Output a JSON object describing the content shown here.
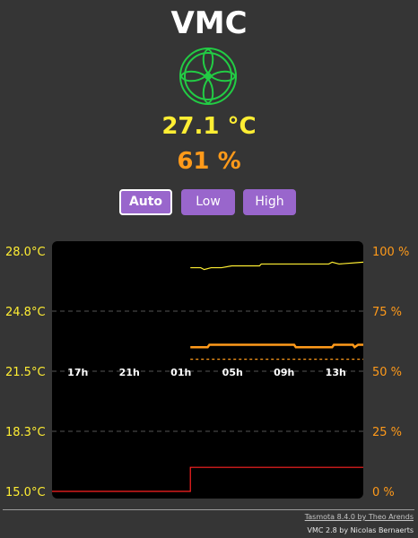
{
  "header": {
    "title": "VMC"
  },
  "readings": {
    "temperature": "27.1 °C",
    "humidity": "61 %"
  },
  "modes": {
    "auto_label": "Auto",
    "low_label": "Low",
    "high_label": "High",
    "selected": "Auto"
  },
  "colors": {
    "background": "#353535",
    "fan_green": "#22cc44",
    "temperature": "#ffee33",
    "humidity": "#ff9a1a",
    "button": "#9966cc",
    "fan_state": "#ff2222"
  },
  "chart_data": {
    "type": "line",
    "x": [
      "17h",
      "21h",
      "01h",
      "05h",
      "09h",
      "13h"
    ],
    "y_left": {
      "ticks": [
        "28.0°C",
        "24.8°C",
        "21.5°C",
        "18.3°C",
        "15.0°C"
      ],
      "range": [
        15.0,
        28.0
      ]
    },
    "y_right": {
      "ticks": [
        "100 %",
        "75 %",
        "50 %",
        "25 %",
        "0 %"
      ],
      "range": [
        0,
        100
      ]
    },
    "grid": true,
    "series": [
      {
        "axis": "left",
        "color": "#ffee33",
        "points": [
          [
            4.0,
            27.1
          ],
          [
            4.3,
            27.1
          ],
          [
            4.4,
            27.0
          ],
          [
            4.6,
            27.1
          ],
          [
            4.9,
            27.1
          ],
          [
            5.2,
            27.2
          ],
          [
            6.0,
            27.2
          ],
          [
            6.05,
            27.3
          ],
          [
            7.0,
            27.3
          ],
          [
            8.0,
            27.3
          ],
          [
            8.1,
            27.4
          ],
          [
            8.3,
            27.3
          ],
          [
            9.0,
            27.4
          ]
        ]
      },
      {
        "axis": "right",
        "color": "#ff9a1a",
        "points": [
          [
            4.0,
            60
          ],
          [
            4.5,
            60
          ],
          [
            4.55,
            61
          ],
          [
            7.0,
            61
          ],
          [
            7.05,
            60
          ],
          [
            8.1,
            60
          ],
          [
            8.15,
            61
          ],
          [
            8.7,
            61
          ],
          [
            8.75,
            60
          ],
          [
            8.85,
            61
          ],
          [
            9.0,
            61
          ]
        ]
      },
      {
        "axis": "right",
        "color": "#ff9a1a",
        "dashed": true,
        "points": [
          [
            4.0,
            55
          ],
          [
            9.0,
            55
          ]
        ]
      },
      {
        "axis": "right",
        "color": "#ff2222",
        "points": [
          [
            0,
            0
          ],
          [
            4.0,
            0
          ],
          [
            4.0,
            10
          ],
          [
            9.0,
            10
          ]
        ]
      }
    ]
  },
  "footer": {
    "firmware": "Tasmota 8.4.0 by Theo Arends",
    "app": "VMC 2.8 by Nicolas Bernaerts"
  }
}
